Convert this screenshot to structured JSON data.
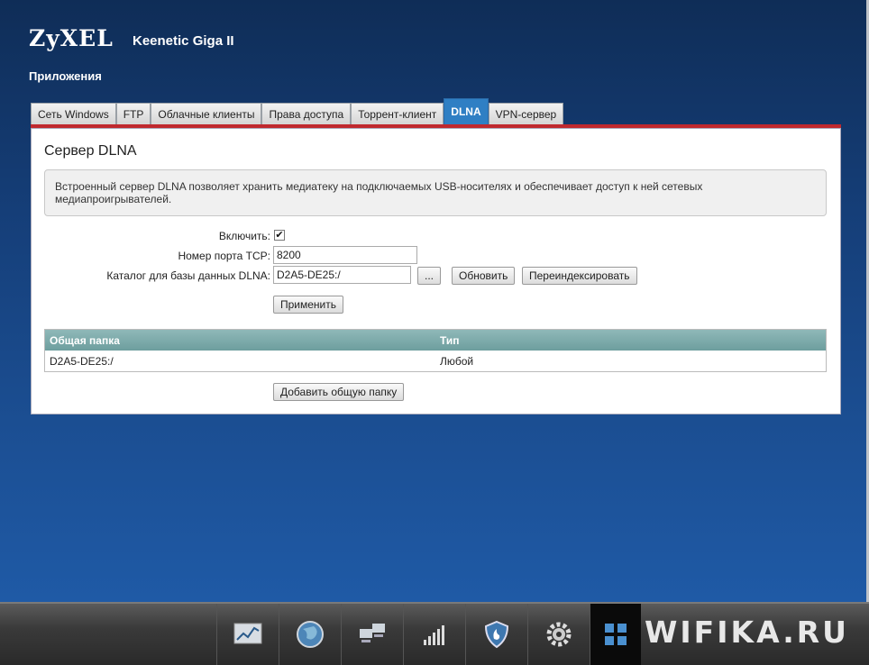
{
  "header": {
    "brand": "ZyXEL",
    "model": "Keenetic Giga II",
    "section": "Приложения"
  },
  "tabs": [
    {
      "label": "Сеть Windows",
      "active": false
    },
    {
      "label": "FTP",
      "active": false
    },
    {
      "label": "Облачные клиенты",
      "active": false
    },
    {
      "label": "Права доступа",
      "active": false
    },
    {
      "label": "Торрент-клиент",
      "active": false
    },
    {
      "label": "DLNA",
      "active": true
    },
    {
      "label": "VPN-сервер",
      "active": false
    }
  ],
  "panel": {
    "title": "Сервер DLNA",
    "info": "Встроенный сервер DLNA позволяет хранить медиатеку на подключаемых USB-носителях и обеспечивает доступ к ней сетевых медиапроигрывателей.",
    "enable_label": "Включить:",
    "enable_checked": true,
    "port_label": "Номер порта TCP:",
    "port_value": "8200",
    "db_label": "Каталог для базы данных DLNA:",
    "db_value": "D2A5-DE25:/",
    "browse_label": "...",
    "refresh_label": "Обновить",
    "reindex_label": "Переиндексировать",
    "apply_label": "Применить",
    "table": {
      "headers": [
        "Общая папка",
        "Тип"
      ],
      "rows": [
        [
          "D2A5-DE25:/",
          "Любой"
        ]
      ]
    },
    "add_label": "Добавить общую папку"
  },
  "taskbar": {
    "icons": [
      "monitor-chart-icon",
      "globe-icon",
      "network-computers-icon",
      "signal-bars-icon",
      "shield-icon",
      "gear-icon",
      "apps-grid-icon"
    ],
    "active": "apps-grid-icon"
  },
  "watermark": "WIFIKA.RU"
}
